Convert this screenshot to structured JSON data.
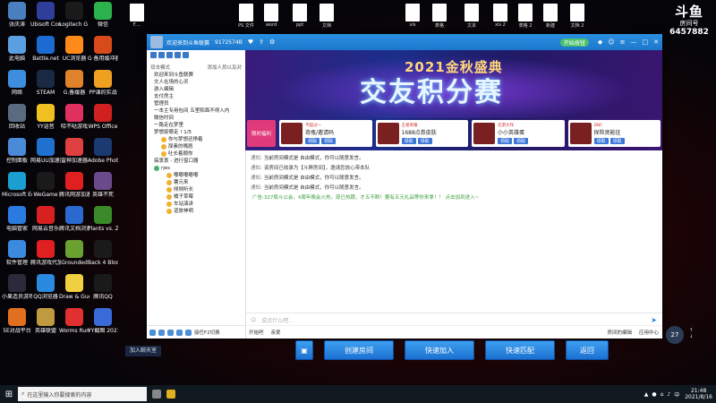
{
  "desktop_icons": [
    {
      "label": "张庆涛",
      "color": "#4a7fc0"
    },
    {
      "label": "Ubisoft Connect",
      "color": "#2f3e9a"
    },
    {
      "label": "Logitech G HUB",
      "color": "#1a1a1a"
    },
    {
      "label": "微信",
      "color": "#2bb24c"
    },
    {
      "label": "此电脑",
      "color": "#5aa0e0"
    },
    {
      "label": "Battle.net",
      "color": "#1b6bd0"
    },
    {
      "label": "UC浏览器",
      "color": "#ff8a1a"
    },
    {
      "label": "G 备用缓冲器",
      "color": "#d84a1a"
    },
    {
      "label": "网络",
      "color": "#3e8ee0"
    },
    {
      "label": "STEAM",
      "color": "#1a2a45"
    },
    {
      "label": "G.备缓器",
      "color": "#e0822a"
    },
    {
      "label": "PP课的实战",
      "color": "#f0a020"
    },
    {
      "label": "回收站",
      "color": "#5a6a80"
    },
    {
      "label": "YY语音",
      "color": "#f0c020"
    },
    {
      "label": "哈不哒游戏",
      "color": "#e03060"
    },
    {
      "label": "WPS Office",
      "color": "#d02020"
    },
    {
      "label": "控制面板",
      "color": "#4a8ad8"
    },
    {
      "label": "网易UU加速器",
      "color": "#2070d0"
    },
    {
      "label": "雷神加速器",
      "color": "#e04040"
    },
    {
      "label": "Adobe Photosh...",
      "color": "#1a3a70"
    },
    {
      "label": "Microsoft Edge",
      "color": "#1aa0d0"
    },
    {
      "label": "WeGame",
      "color": "#1a1a1a"
    },
    {
      "label": "腾讯网游加速器",
      "color": "#e02020"
    },
    {
      "label": "英雄不死",
      "color": "#6a4a8a"
    },
    {
      "label": "电脑管家",
      "color": "#2a7ae0"
    },
    {
      "label": "网易云音乐",
      "color": "#d82020"
    },
    {
      "label": "腾讯文档浏览",
      "color": "#2a6ad0"
    },
    {
      "label": "Plants vs. Zombies Ga...",
      "color": "#3a8a2a"
    },
    {
      "label": "软件管理",
      "color": "#3a8ae0"
    },
    {
      "label": "腾讯游戏代加速器",
      "color": "#e02020"
    },
    {
      "label": "Grounded",
      "color": "#6aa030"
    },
    {
      "label": "Back 4 Blood Beta",
      "color": "#1a1a1a"
    },
    {
      "label": "小果造员游戏",
      "color": "#2a2a3a"
    },
    {
      "label": "QQ浏览器",
      "color": "#2a8ae0"
    },
    {
      "label": "Draw & Guess",
      "color": "#f0d040"
    },
    {
      "label": "腾讯QQ",
      "color": "#1a1a1a"
    },
    {
      "label": "5E对战平台",
      "color": "#e07020"
    },
    {
      "label": "英雄联盟",
      "color": "#c09a40"
    },
    {
      "label": "Worms Rumble",
      "color": "#e03030"
    },
    {
      "label": "YY截图 20210816...",
      "color": "#3a6ad8"
    }
  ],
  "top_files": [
    {
      "label": "F...."
    },
    {
      "label": "PS 文件"
    },
    {
      "label": "word"
    },
    {
      "label": "ppt"
    },
    {
      "label": "文档"
    },
    {
      "label": "xls"
    },
    {
      "label": "表格"
    },
    {
      "label": "文本"
    },
    {
      "label": "xls 2"
    },
    {
      "label": "表格 2"
    },
    {
      "label": "新建"
    },
    {
      "label": "文档 2"
    }
  ],
  "watermark": {
    "logo": "斗鱼",
    "room_label": "房间号",
    "room_no": "6457882"
  },
  "app": {
    "title": "欢迎来到斗鱼联赛",
    "subtitle": "9172574B",
    "title_badge": "开始按钮",
    "left_header": {
      "left": "双击模式",
      "right": "添加人员以及对"
    },
    "tree": [
      {
        "text": "欢迎来到斗鱼联赛",
        "level": 1,
        "icon": ""
      },
      {
        "text": "文人在场的心灵",
        "level": 1,
        "icon": ""
      },
      {
        "text": "游入编辑",
        "level": 1,
        "icon": ""
      },
      {
        "text": "支付房主",
        "level": 1,
        "icon": ""
      },
      {
        "text": "管理员",
        "level": 1,
        "icon": ""
      },
      {
        "text": "一本主专用包间   五里和面不得入内",
        "level": 1,
        "icon": ""
      },
      {
        "text": "微信时间",
        "level": 1,
        "icon": ""
      },
      {
        "text": "一路走在梦里",
        "level": 1,
        "icon": ""
      },
      {
        "text": "梦想捉哪走 ! 1/5",
        "level": 1,
        "icon": ""
      },
      {
        "text": "你与梦想还挣着",
        "level": 2,
        "icon": "y"
      },
      {
        "text": "尿素的嘴唇",
        "level": 2,
        "icon": "y"
      },
      {
        "text": "吐长着顺你",
        "level": 2,
        "icon": "y"
      },
      {
        "text": "搞衷衷 - 进行窗口器",
        "level": 1,
        "icon": ""
      },
      {
        "text": "rjes",
        "level": 1,
        "icon": "c"
      },
      {
        "text": "嘟嘟嘟嘟嘟",
        "level": 3,
        "icon": "y"
      },
      {
        "text": "薯元来",
        "level": 3,
        "icon": "y"
      },
      {
        "text": "倾倾听长",
        "level": 3,
        "icon": "y"
      },
      {
        "text": "橘子草莓",
        "level": 3,
        "icon": "y"
      },
      {
        "text": "车站演讲",
        "level": 3,
        "icon": "y"
      },
      {
        "text": "道旅神明",
        "level": 3,
        "icon": "y"
      }
    ],
    "left_bottom_text": "接任F2切换",
    "banner": {
      "year": "2021金秋盛典",
      "main": "交友积分赛"
    },
    "cards": [
      {
        "badge": "小编",
        "title": "",
        "btn1": "",
        "btn2": "",
        "first": true,
        "first_label": "限时福利"
      },
      {
        "badge": "不超过一",
        "title": "奇瓶/邀请码",
        "btn1": "领取",
        "btn2": "领取",
        "first": false
      },
      {
        "badge": "王者荣耀",
        "title": "1688点券皮肤",
        "btn1": "领取",
        "btn2": "领取",
        "first": false
      },
      {
        "badge": "云游大作",
        "title": "小小英雄蛋",
        "btn1": "领取",
        "btn2": "领取",
        "first": false
      },
      {
        "badge": "DNF",
        "title": "探险贤能征",
        "btn1": "领取",
        "btn2": "领取",
        "first": false
      }
    ],
    "messages": [
      {
        "tag": "通知:",
        "text": "当前房间模式是 自由模式，你可以随意发言。",
        "green": false
      },
      {
        "tag": "通知:",
        "text": "该房间已收录为【斗屏房间】，邀请您放心带本队",
        "green": false
      },
      {
        "tag": "通知:",
        "text": "当前房间模式是 自由模式，你可以随意发言。",
        "green": false
      },
      {
        "tag": "通知:",
        "text": "当前房间模式是 自由模式，你可以随意发言。",
        "green": false
      },
      {
        "tag": "",
        "text": "广告:327局斗公会，4周年晚会火热，现已热跟，才五不断！要有五元礼品等你来拿！！ 点击加到进入~",
        "green": true
      }
    ],
    "input_placeholder": "说点什么吧...",
    "footer": {
      "left1": "开始吧",
      "left2": "亲爱",
      "right1": "房间的编辑",
      "right2": "应用中心"
    }
  },
  "buttons": {
    "create": "创建房间",
    "quick_join": "快速加入",
    "quick_match": "快速匹配",
    "back": "返回",
    "add_friend": "加入聊天室"
  },
  "taskbar": {
    "search": "在这里输入你要搜索的内容",
    "time": "21:48",
    "date": "2021/8/16",
    "perf": "27"
  }
}
